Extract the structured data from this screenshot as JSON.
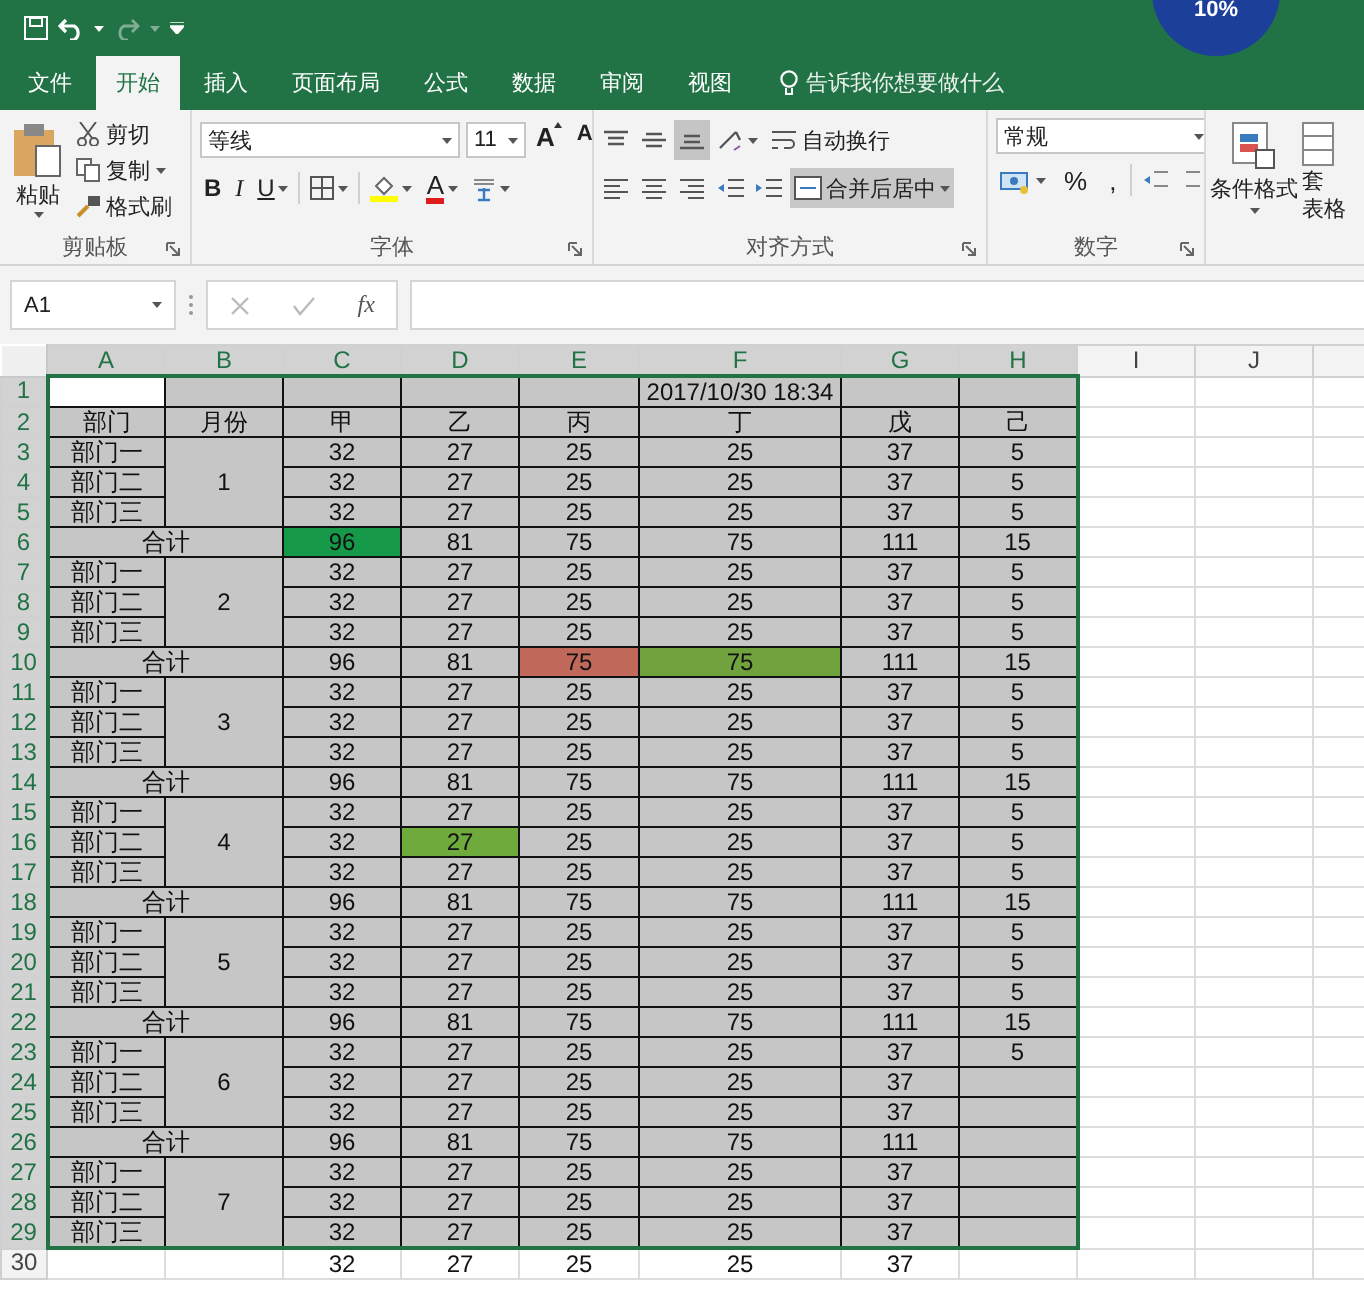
{
  "badge": {
    "text": "10%"
  },
  "tabs": [
    {
      "label": "文件",
      "selected": false
    },
    {
      "label": "开始",
      "selected": true
    },
    {
      "label": "插入",
      "selected": false
    },
    {
      "label": "页面布局",
      "selected": false
    },
    {
      "label": "公式",
      "selected": false
    },
    {
      "label": "数据",
      "selected": false
    },
    {
      "label": "审阅",
      "selected": false
    },
    {
      "label": "视图",
      "selected": false
    }
  ],
  "tell_me": {
    "placeholder": "告诉我你想要做什么"
  },
  "ribbon": {
    "clipboard": {
      "title": "剪贴板",
      "paste": "粘贴",
      "items": [
        {
          "kind": "cut",
          "label": "剪切"
        },
        {
          "kind": "copy",
          "label": "复制"
        },
        {
          "kind": "painter",
          "label": "格式刷"
        }
      ]
    },
    "font": {
      "title": "字体",
      "font_name": "等线",
      "font_size": "11",
      "grow": "A",
      "shrink": "A",
      "styles": [
        {
          "kind": "bold",
          "label": "B"
        },
        {
          "kind": "italic",
          "label": "I"
        },
        {
          "kind": "underline",
          "label": "U"
        }
      ],
      "font_color": "A"
    },
    "alignment": {
      "title": "对齐方式",
      "vertical": [
        {
          "kind": "top",
          "selected": false
        },
        {
          "kind": "middle",
          "selected": false
        },
        {
          "kind": "bottom",
          "selected": true
        }
      ],
      "horizontal": [
        {
          "kind": "left",
          "selected": false
        },
        {
          "kind": "center",
          "selected": false
        },
        {
          "kind": "right",
          "selected": false
        }
      ],
      "wrap": "自动换行",
      "merge": {
        "label": "合并后居中",
        "selected": true
      }
    },
    "number": {
      "title": "数字",
      "format": "常规",
      "percent": "%",
      "comma": ","
    },
    "styles": {
      "conditional": "条件格式",
      "table_top": "套",
      "table_bottom": "表格"
    }
  },
  "formula_bar": {
    "name_box": "A1",
    "function_label": "fx"
  },
  "sheet": {
    "columns": [
      {
        "label": "A",
        "selected": true
      },
      {
        "label": "B",
        "selected": true
      },
      {
        "label": "C",
        "selected": true
      },
      {
        "label": "D",
        "selected": true
      },
      {
        "label": "E",
        "selected": true
      },
      {
        "label": "F",
        "selected": true
      },
      {
        "label": "G",
        "selected": true
      },
      {
        "label": "H",
        "selected": true
      },
      {
        "label": "I",
        "selected": false
      },
      {
        "label": "J",
        "selected": false
      }
    ],
    "row_headers": [
      {
        "label": "1",
        "selected": true
      },
      {
        "label": "2",
        "selected": true
      },
      {
        "label": "3",
        "selected": true
      },
      {
        "label": "4",
        "selected": true
      },
      {
        "label": "5",
        "selected": true
      },
      {
        "label": "6",
        "selected": true
      },
      {
        "label": "7",
        "selected": true
      },
      {
        "label": "8",
        "selected": true
      },
      {
        "label": "9",
        "selected": true
      },
      {
        "label": "10",
        "selected": true
      },
      {
        "label": "11",
        "selected": true
      },
      {
        "label": "12",
        "selected": true
      },
      {
        "label": "13",
        "selected": true
      },
      {
        "label": "14",
        "selected": true
      },
      {
        "label": "15",
        "selected": true
      },
      {
        "label": "16",
        "selected": true
      },
      {
        "label": "17",
        "selected": true
      },
      {
        "label": "18",
        "selected": true
      },
      {
        "label": "19",
        "selected": true
      },
      {
        "label": "20",
        "selected": true
      },
      {
        "label": "21",
        "selected": true
      },
      {
        "label": "22",
        "selected": true
      },
      {
        "label": "23",
        "selected": true
      },
      {
        "label": "24",
        "selected": true
      },
      {
        "label": "25",
        "selected": true
      },
      {
        "label": "26",
        "selected": true
      },
      {
        "label": "27",
        "selected": true
      },
      {
        "label": "28",
        "selected": true
      },
      {
        "label": "29",
        "selected": true
      },
      {
        "label": "30",
        "selected": false
      }
    ],
    "title_date": "2017/10/30 18:34",
    "header": [
      "部门",
      "月份",
      "甲",
      "乙",
      "丙",
      "丁",
      "戊",
      "己"
    ],
    "groups": [
      {
        "month": "1",
        "departments": [
          {
            "name": "部门一",
            "values": [
              "32",
              "27",
              "25",
              "25",
              "37",
              "5"
            ]
          },
          {
            "name": "部门二",
            "values": [
              "32",
              "27",
              "25",
              "25",
              "37",
              "5"
            ]
          },
          {
            "name": "部门三",
            "values": [
              "32",
              "27",
              "25",
              "25",
              "37",
              "5"
            ]
          }
        ],
        "total": {
          "label": "合计",
          "values": [
            {
              "text": "96",
              "color": "#17994a"
            },
            "81",
            "75",
            "75",
            "111",
            "15"
          ]
        }
      },
      {
        "month": "2",
        "departments": [
          {
            "name": "部门一",
            "values": [
              "32",
              "27",
              "25",
              "25",
              "37",
              "5"
            ]
          },
          {
            "name": "部门二",
            "values": [
              "32",
              "27",
              "25",
              "25",
              "37",
              "5"
            ]
          },
          {
            "name": "部门三",
            "values": [
              "32",
              "27",
              "25",
              "25",
              "37",
              "5"
            ]
          }
        ],
        "total": {
          "label": "合计",
          "values": [
            "96",
            "81",
            {
              "text": "75",
              "color": "#c0695a"
            },
            {
              "text": "75",
              "color": "#70a23e"
            },
            "111",
            "15"
          ]
        }
      },
      {
        "month": "3",
        "departments": [
          {
            "name": "部门一",
            "values": [
              "32",
              "27",
              "25",
              "25",
              "37",
              "5"
            ]
          },
          {
            "name": "部门二",
            "values": [
              "32",
              "27",
              "25",
              "25",
              "37",
              "5"
            ]
          },
          {
            "name": "部门三",
            "values": [
              "32",
              "27",
              "25",
              "25",
              "37",
              "5"
            ]
          }
        ],
        "total": {
          "label": "合计",
          "values": [
            "96",
            "81",
            "75",
            "75",
            "111",
            "15"
          ]
        }
      },
      {
        "month": "4",
        "departments": [
          {
            "name": "部门一",
            "values": [
              "32",
              "27",
              "25",
              "25",
              "37",
              "5"
            ]
          },
          {
            "name": "部门二",
            "values": [
              "32",
              {
                "text": "27",
                "color": "#6eaa3c"
              },
              "25",
              "25",
              "37",
              "5"
            ]
          },
          {
            "name": "部门三",
            "values": [
              "32",
              "27",
              "25",
              "25",
              "37",
              "5"
            ]
          }
        ],
        "total": {
          "label": "合计",
          "values": [
            "96",
            "81",
            "75",
            "75",
            "111",
            "15"
          ]
        }
      },
      {
        "month": "5",
        "departments": [
          {
            "name": "部门一",
            "values": [
              "32",
              "27",
              "25",
              "25",
              "37",
              "5"
            ]
          },
          {
            "name": "部门二",
            "values": [
              "32",
              "27",
              "25",
              "25",
              "37",
              "5"
            ]
          },
          {
            "name": "部门三",
            "values": [
              "32",
              "27",
              "25",
              "25",
              "37",
              "5"
            ]
          }
        ],
        "total": {
          "label": "合计",
          "values": [
            "96",
            "81",
            "75",
            "75",
            "111",
            "15"
          ]
        }
      },
      {
        "month": "6",
        "departments": [
          {
            "name": "部门一",
            "values": [
              "32",
              "27",
              "25",
              "25",
              "37",
              "5"
            ]
          },
          {
            "name": "部门二",
            "values": [
              "32",
              "27",
              "25",
              "25",
              "37"
            ]
          },
          {
            "name": "部门三",
            "values": [
              "32",
              "27",
              "25",
              "25",
              "37"
            ]
          }
        ],
        "total": {
          "label": "合计",
          "values": [
            "96",
            "81",
            "75",
            "75",
            "111"
          ]
        }
      },
      {
        "month": "7",
        "departments": [
          {
            "name": "部门一",
            "values": [
              "32",
              "27",
              "25",
              "25",
              "37"
            ]
          },
          {
            "name": "部门二",
            "values": [
              "32",
              "27",
              "25",
              "25",
              "37"
            ]
          },
          {
            "name": "部门三",
            "values": [
              "32",
              "27",
              "25",
              "25",
              "37"
            ]
          }
        ]
      }
    ],
    "extra_row": {
      "values": [
        "32",
        "27",
        "25",
        "25",
        "37"
      ]
    }
  }
}
